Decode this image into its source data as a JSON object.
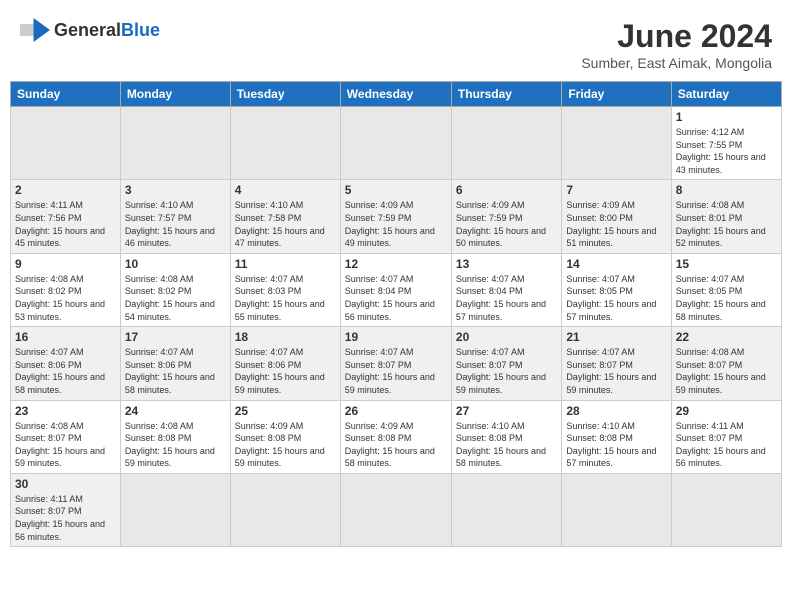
{
  "header": {
    "logo_general": "General",
    "logo_blue": "Blue",
    "month_title": "June 2024",
    "location": "Sumber, East Aimak, Mongolia"
  },
  "weekdays": [
    "Sunday",
    "Monday",
    "Tuesday",
    "Wednesday",
    "Thursday",
    "Friday",
    "Saturday"
  ],
  "weeks": [
    [
      {
        "day": "",
        "info": ""
      },
      {
        "day": "",
        "info": ""
      },
      {
        "day": "",
        "info": ""
      },
      {
        "day": "",
        "info": ""
      },
      {
        "day": "",
        "info": ""
      },
      {
        "day": "",
        "info": ""
      },
      {
        "day": "1",
        "info": "Sunrise: 4:12 AM\nSunset: 7:55 PM\nDaylight: 15 hours and 43 minutes."
      }
    ],
    [
      {
        "day": "2",
        "info": "Sunrise: 4:11 AM\nSunset: 7:56 PM\nDaylight: 15 hours and 45 minutes."
      },
      {
        "day": "3",
        "info": "Sunrise: 4:10 AM\nSunset: 7:57 PM\nDaylight: 15 hours and 46 minutes."
      },
      {
        "day": "4",
        "info": "Sunrise: 4:10 AM\nSunset: 7:58 PM\nDaylight: 15 hours and 47 minutes."
      },
      {
        "day": "5",
        "info": "Sunrise: 4:09 AM\nSunset: 7:59 PM\nDaylight: 15 hours and 49 minutes."
      },
      {
        "day": "6",
        "info": "Sunrise: 4:09 AM\nSunset: 7:59 PM\nDaylight: 15 hours and 50 minutes."
      },
      {
        "day": "7",
        "info": "Sunrise: 4:09 AM\nSunset: 8:00 PM\nDaylight: 15 hours and 51 minutes."
      },
      {
        "day": "8",
        "info": "Sunrise: 4:08 AM\nSunset: 8:01 PM\nDaylight: 15 hours and 52 minutes."
      }
    ],
    [
      {
        "day": "9",
        "info": "Sunrise: 4:08 AM\nSunset: 8:02 PM\nDaylight: 15 hours and 53 minutes."
      },
      {
        "day": "10",
        "info": "Sunrise: 4:08 AM\nSunset: 8:02 PM\nDaylight: 15 hours and 54 minutes."
      },
      {
        "day": "11",
        "info": "Sunrise: 4:07 AM\nSunset: 8:03 PM\nDaylight: 15 hours and 55 minutes."
      },
      {
        "day": "12",
        "info": "Sunrise: 4:07 AM\nSunset: 8:04 PM\nDaylight: 15 hours and 56 minutes."
      },
      {
        "day": "13",
        "info": "Sunrise: 4:07 AM\nSunset: 8:04 PM\nDaylight: 15 hours and 57 minutes."
      },
      {
        "day": "14",
        "info": "Sunrise: 4:07 AM\nSunset: 8:05 PM\nDaylight: 15 hours and 57 minutes."
      },
      {
        "day": "15",
        "info": "Sunrise: 4:07 AM\nSunset: 8:05 PM\nDaylight: 15 hours and 58 minutes."
      }
    ],
    [
      {
        "day": "16",
        "info": "Sunrise: 4:07 AM\nSunset: 8:06 PM\nDaylight: 15 hours and 58 minutes."
      },
      {
        "day": "17",
        "info": "Sunrise: 4:07 AM\nSunset: 8:06 PM\nDaylight: 15 hours and 58 minutes."
      },
      {
        "day": "18",
        "info": "Sunrise: 4:07 AM\nSunset: 8:06 PM\nDaylight: 15 hours and 59 minutes."
      },
      {
        "day": "19",
        "info": "Sunrise: 4:07 AM\nSunset: 8:07 PM\nDaylight: 15 hours and 59 minutes."
      },
      {
        "day": "20",
        "info": "Sunrise: 4:07 AM\nSunset: 8:07 PM\nDaylight: 15 hours and 59 minutes."
      },
      {
        "day": "21",
        "info": "Sunrise: 4:07 AM\nSunset: 8:07 PM\nDaylight: 15 hours and 59 minutes."
      },
      {
        "day": "22",
        "info": "Sunrise: 4:08 AM\nSunset: 8:07 PM\nDaylight: 15 hours and 59 minutes."
      }
    ],
    [
      {
        "day": "23",
        "info": "Sunrise: 4:08 AM\nSunset: 8:07 PM\nDaylight: 15 hours and 59 minutes."
      },
      {
        "day": "24",
        "info": "Sunrise: 4:08 AM\nSunset: 8:08 PM\nDaylight: 15 hours and 59 minutes."
      },
      {
        "day": "25",
        "info": "Sunrise: 4:09 AM\nSunset: 8:08 PM\nDaylight: 15 hours and 59 minutes."
      },
      {
        "day": "26",
        "info": "Sunrise: 4:09 AM\nSunset: 8:08 PM\nDaylight: 15 hours and 58 minutes."
      },
      {
        "day": "27",
        "info": "Sunrise: 4:10 AM\nSunset: 8:08 PM\nDaylight: 15 hours and 58 minutes."
      },
      {
        "day": "28",
        "info": "Sunrise: 4:10 AM\nSunset: 8:08 PM\nDaylight: 15 hours and 57 minutes."
      },
      {
        "day": "29",
        "info": "Sunrise: 4:11 AM\nSunset: 8:07 PM\nDaylight: 15 hours and 56 minutes."
      }
    ],
    [
      {
        "day": "30",
        "info": "Sunrise: 4:11 AM\nSunset: 8:07 PM\nDaylight: 15 hours and 56 minutes."
      },
      {
        "day": "",
        "info": ""
      },
      {
        "day": "",
        "info": ""
      },
      {
        "day": "",
        "info": ""
      },
      {
        "day": "",
        "info": ""
      },
      {
        "day": "",
        "info": ""
      },
      {
        "day": "",
        "info": ""
      }
    ]
  ]
}
